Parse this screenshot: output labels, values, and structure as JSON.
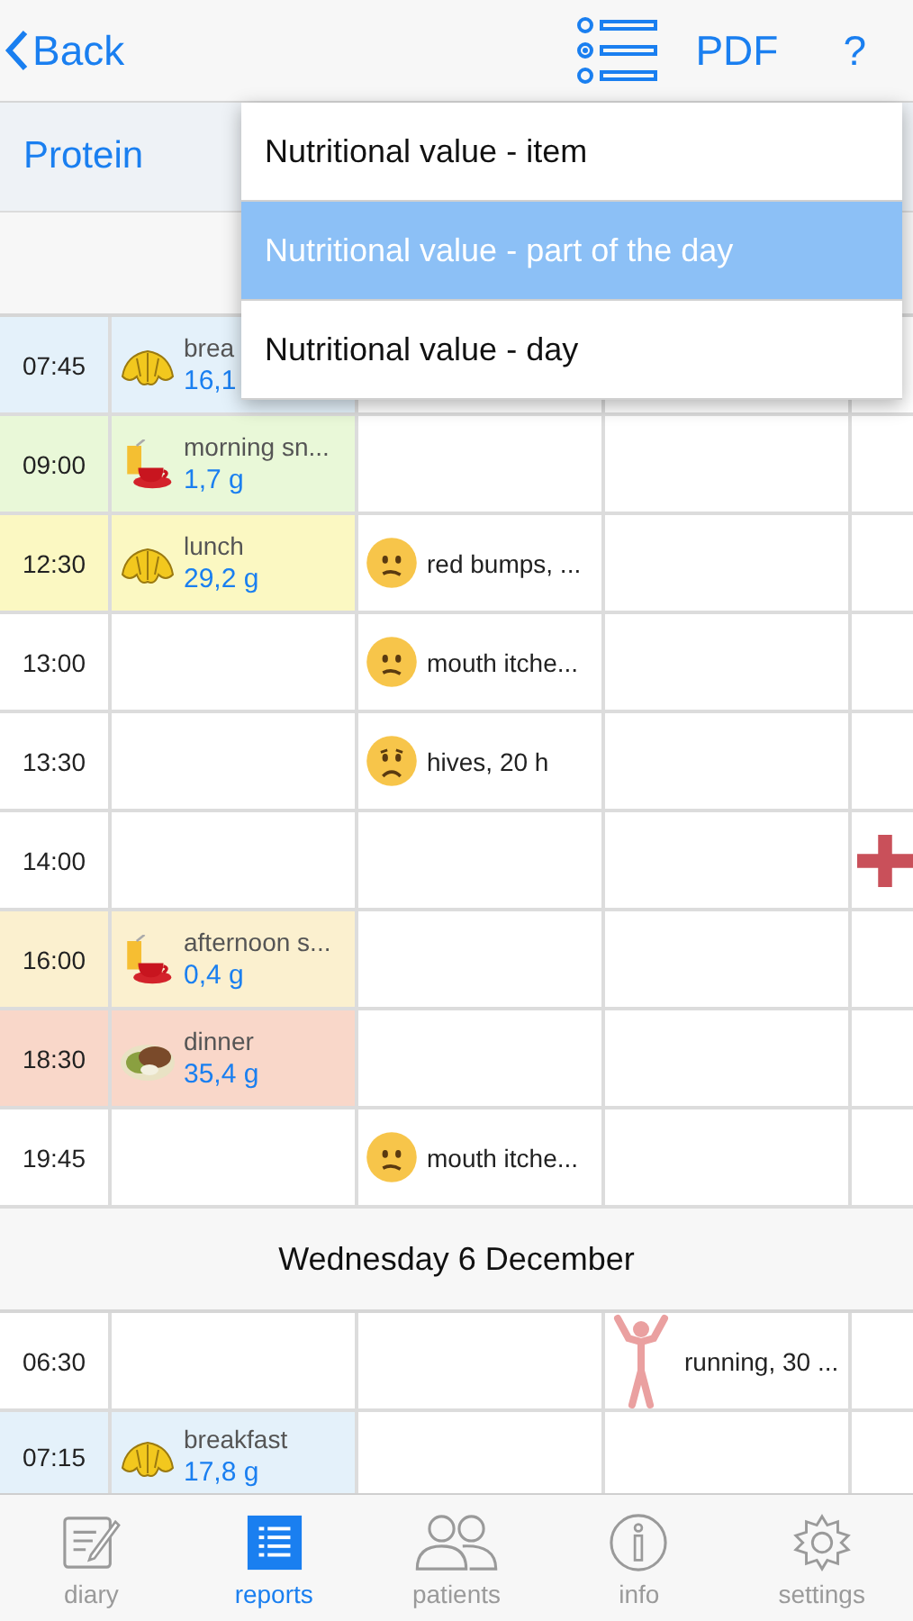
{
  "nav": {
    "back": "Back",
    "pdf": "PDF",
    "help": "?"
  },
  "header": {
    "title": "Protein"
  },
  "menu": [
    {
      "label": "Nutritional value - item",
      "selected": false
    },
    {
      "label": "Nutritional value - part of the day",
      "selected": true
    },
    {
      "label": "Nutritional value - day",
      "selected": false
    }
  ],
  "days": [
    {
      "rows": [
        {
          "time": "07:45",
          "color": "#e4f1fa",
          "meal": {
            "kind": "croissant",
            "name": "brea",
            "amount": "16,1"
          }
        },
        {
          "time": "09:00",
          "color": "#e9f8d8",
          "meal": {
            "kind": "drinks",
            "name": "morning sn...",
            "amount": "1,7 g"
          }
        },
        {
          "time": "12:30",
          "color": "#fbf8c2",
          "meal": {
            "kind": "croissant",
            "name": "lunch",
            "amount": "29,2 g"
          },
          "symptom": {
            "kind": "mild",
            "text": "red bumps, ..."
          }
        },
        {
          "time": "13:00",
          "symptom": {
            "kind": "mild",
            "text": "mouth itche..."
          }
        },
        {
          "time": "13:30",
          "symptom": {
            "kind": "worried",
            "text": "hives, 20 h"
          }
        },
        {
          "time": "14:00",
          "add": true
        },
        {
          "time": "16:00",
          "color": "#fbf0cf",
          "meal": {
            "kind": "drinks",
            "name": "afternoon s...",
            "amount": "0,4 g"
          }
        },
        {
          "time": "18:30",
          "color": "#f9d7c9",
          "meal": {
            "kind": "dinner",
            "name": "dinner",
            "amount": "35,4 g"
          }
        },
        {
          "time": "19:45",
          "symptom": {
            "kind": "mild",
            "text": "mouth itche..."
          }
        }
      ]
    },
    {
      "title": "Wednesday 6 December",
      "rows": [
        {
          "time": "06:30",
          "activity": {
            "text": "running, 30 ..."
          }
        },
        {
          "time": "07:15",
          "color": "#e4f1fa",
          "meal": {
            "kind": "croissant",
            "name": "breakfast",
            "amount": "17,8 g"
          }
        }
      ]
    }
  ],
  "tabs": [
    {
      "label": "diary",
      "kind": "diary",
      "selected": false
    },
    {
      "label": "reports",
      "kind": "reports",
      "selected": true
    },
    {
      "label": "patients",
      "kind": "patients",
      "selected": false
    },
    {
      "label": "info",
      "kind": "info",
      "selected": false
    },
    {
      "label": "settings",
      "kind": "settings",
      "selected": false
    }
  ]
}
